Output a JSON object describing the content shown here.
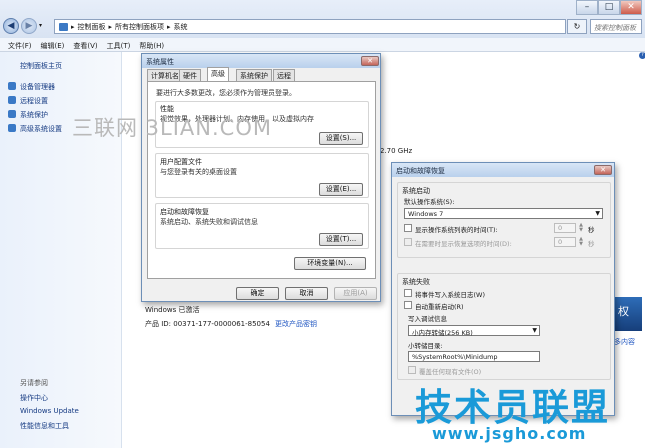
{
  "address": {
    "path": [
      "控制面板",
      "所有控制面板项",
      "系统"
    ],
    "search_placeholder": "搜索控制面板"
  },
  "menu": [
    "文件(F)",
    "编辑(E)",
    "查看(V)",
    "工具(T)",
    "帮助(H)"
  ],
  "sidebar": {
    "home": "控制面板主页",
    "items": [
      "设备管理器",
      "远程设置",
      "系统保护",
      "高级系统设置"
    ],
    "see_also_title": "另请参阅",
    "see_also": [
      "操作中心",
      "Windows Update",
      "性能信息和工具"
    ]
  },
  "main": {
    "cpu_fragment": "2.70 GHz",
    "windows_activated": "Windows 已激活",
    "product_id": "产品 ID: 00371-177-0000061-85054",
    "change_key": "更改产品密钥",
    "more_online": "多内容",
    "badge": "权"
  },
  "sysprop": {
    "title": "系统属性",
    "tabs": [
      "计算机名",
      "硬件",
      "高级",
      "系统保护",
      "远程"
    ],
    "active_tab": 2,
    "admin_note": "要进行大多数更改，您必须作为管理员登录。",
    "groups": [
      {
        "title": "性能",
        "desc": "视觉效果，处理器计划，内存使用，以及虚拟内存",
        "button": "设置(S)..."
      },
      {
        "title": "用户配置文件",
        "desc": "与您登录有关的桌面设置",
        "button": "设置(E)..."
      },
      {
        "title": "启动和故障恢复",
        "desc": "系统启动、系统失败和调试信息",
        "button": "设置(T)..."
      }
    ],
    "env_button": "环境变量(N)...",
    "ok": "确定",
    "cancel": "取消",
    "apply": "应用(A)"
  },
  "startup": {
    "title": "启动和故障恢复",
    "boot_group": "系统启动",
    "default_os_label": "默认操作系统(S):",
    "default_os": "Windows 7",
    "show_os_list": "显示操作系统列表的时间(T):",
    "show_recovery": "在需要时显示恢复选项的时间(D):",
    "os_list_seconds": "0",
    "recovery_seconds": "0",
    "seconds_unit": "秒",
    "failure_group": "系统失败",
    "write_event": "将事件写入系统日志(W)",
    "auto_restart": "自动重新启动(R)",
    "debug_info": "写入调试信息",
    "dump_type": "小内存转储(256 KB)",
    "dump_dir_label": "小转储目录:",
    "dump_dir": "%SystemRoot%\\Minidump",
    "overwrite": "覆盖任何现有文件(O)"
  },
  "watermarks": {
    "top": "三联网 3LIAN.COM",
    "brand": "技术员联盟",
    "url": "www.jsgho.com"
  },
  "colors": {
    "link": "#1f56c2",
    "brand": "#1a9ad8"
  }
}
